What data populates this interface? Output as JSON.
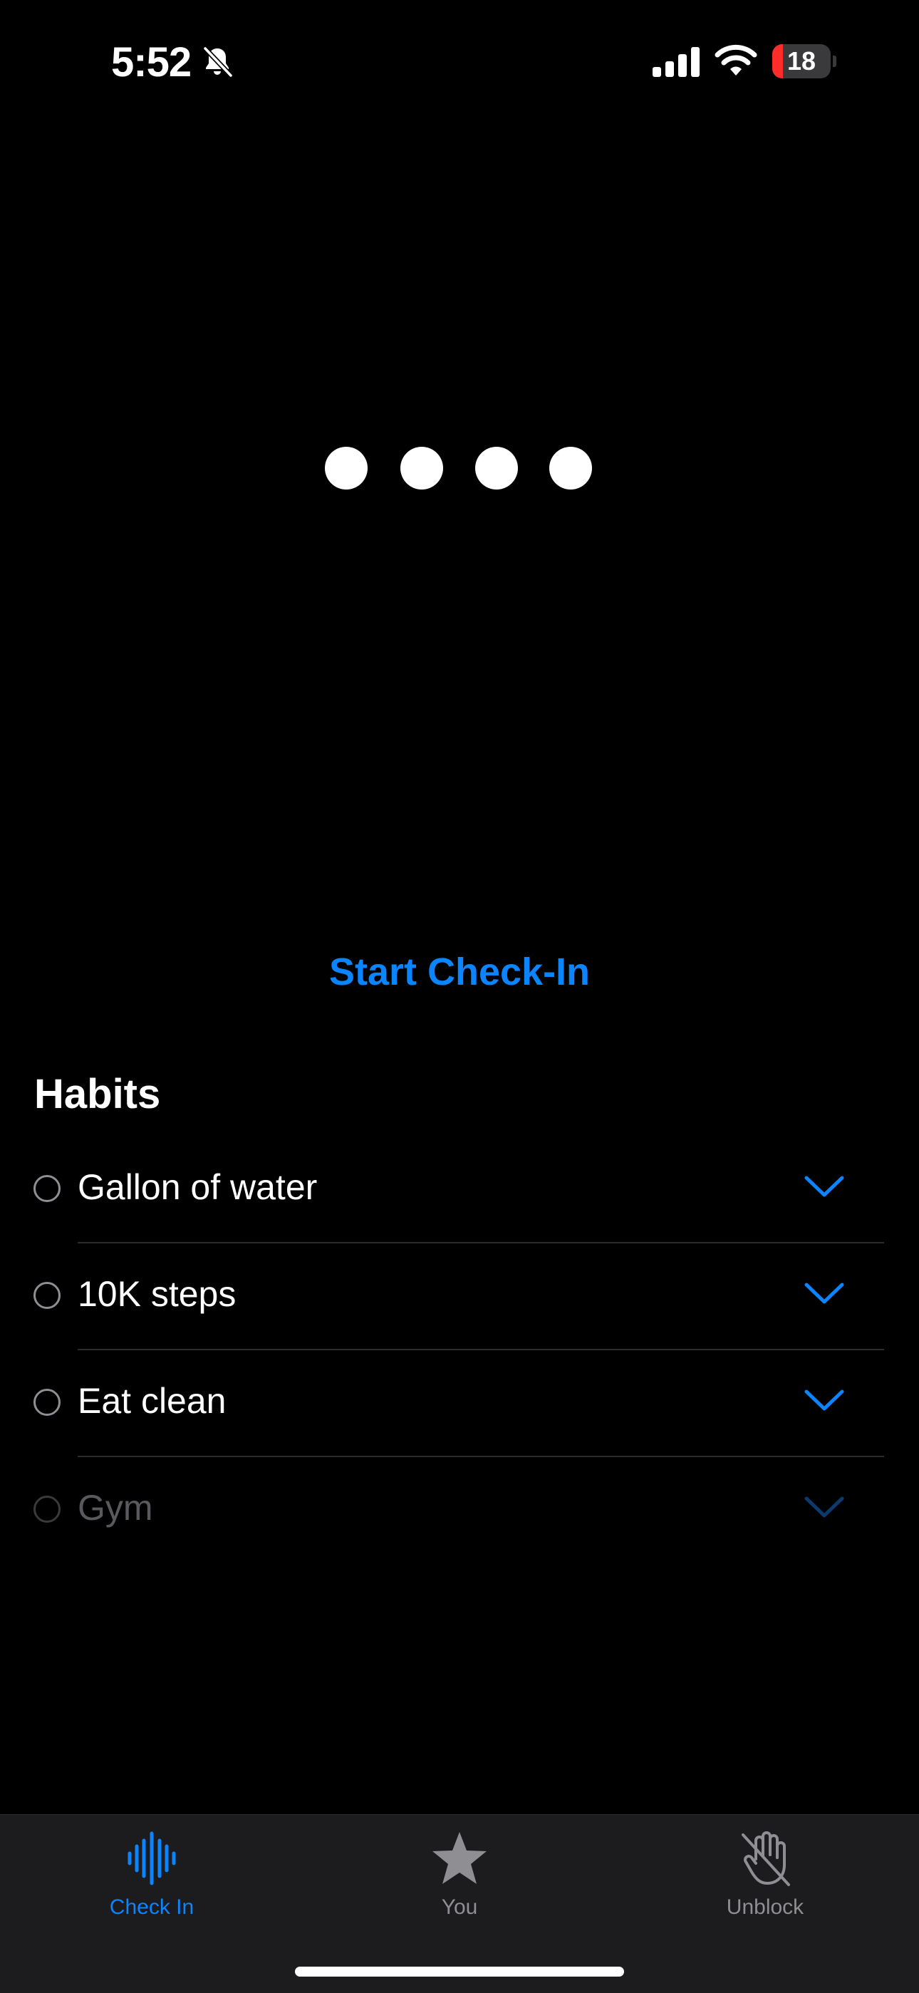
{
  "status_bar": {
    "time": "5:52",
    "battery_level": "18",
    "battery_fraction": 0.18,
    "icons": [
      "bell-slash-icon",
      "cellular-signal-icon",
      "wifi-icon",
      "battery-icon"
    ]
  },
  "passcode_dots": {
    "count": 4,
    "icon": "filled-circle"
  },
  "start_checkin_label": "Start Check-In",
  "habits": {
    "title": "Habits",
    "items": [
      {
        "label": "Gallon of water",
        "checked": false
      },
      {
        "label": "10K steps",
        "checked": false
      },
      {
        "label": "Eat clean",
        "checked": false
      },
      {
        "label": "Gym",
        "checked": false
      }
    ]
  },
  "tab_bar": {
    "tabs": [
      {
        "label": "Check In",
        "icon": "waveform-icon",
        "active": true
      },
      {
        "label": "You",
        "icon": "star-icon",
        "active": false
      },
      {
        "label": "Unblock",
        "icon": "hand-slash-icon",
        "active": false
      }
    ]
  },
  "colors": {
    "background": "#000000",
    "accent": "#0a84ff",
    "tab_bar_background": "#1c1c1e",
    "inactive_gray": "#8e8e93",
    "battery_low": "#ff2d2a"
  }
}
